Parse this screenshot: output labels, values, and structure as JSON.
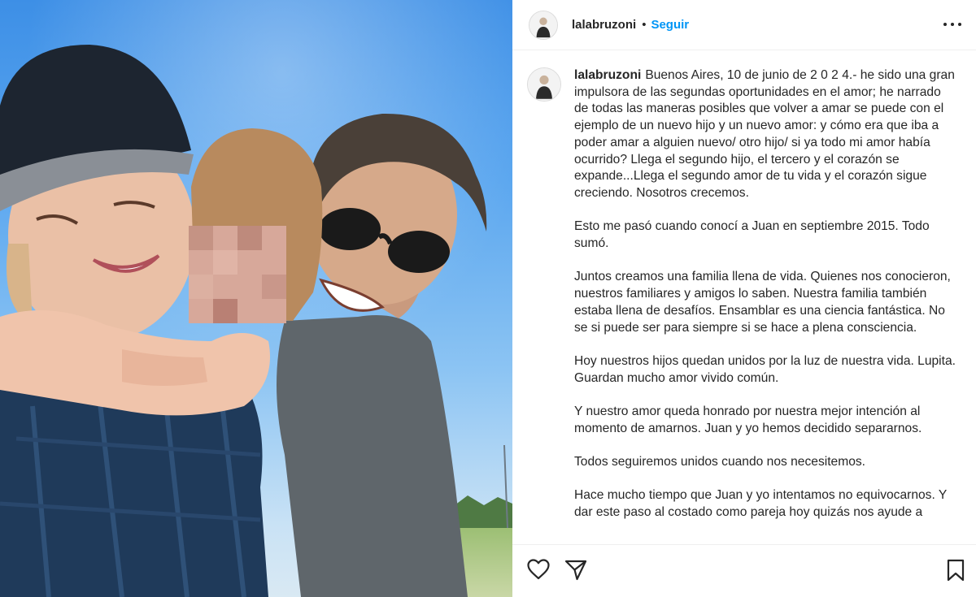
{
  "post": {
    "username": "lalabruzoni",
    "separator": "•",
    "follow_label": "Seguir"
  },
  "caption": {
    "username": "lalabruzoni",
    "paragraphs": [
      "Buenos Aires, 10 de junio de 2 0 2 4.- he sido una gran impulsora de las segundas oportunidades en el amor; he narrado de todas las maneras posibles que volver a amar se puede con el ejemplo de un nuevo hijo y un nuevo amor: y cómo era que iba a poder amar a alguien nuevo/ otro hijo/ si ya todo mi amor había ocurrido? Llega el segundo hijo, el tercero y el corazón se expande...Llega el segundo amor de tu vida y el corazón sigue creciendo. Nosotros crecemos.",
      "Esto me pasó cuando conocí a Juan en septiembre 2015. Todo sumó.",
      "Juntos creamos una familia llena de vida. Quienes nos conocieron, nuestros familiares y amigos lo saben. Nuestra familia también estaba llena de desafíos. Ensamblar es una ciencia fantástica. No se si puede ser para siempre si se hace a plena consciencia.",
      "Hoy nuestros hijos quedan unidos por la luz de nuestra vida. Lupita. Guardan mucho amor vivido común.",
      "Y nuestro amor queda honrado por nuestra mejor intención al momento de amarnos. Juan y yo hemos decidido separarnos.",
      "Todos seguiremos unidos cuando nos necesitemos.",
      "Hace mucho tiempo que Juan y yo intentamos no equivocarnos. Y dar este paso al costado como pareja hoy quizás nos ayude a"
    ]
  },
  "icons": {
    "more": "more-horizontal-icon",
    "like": "heart-icon",
    "share": "paper-plane-icon",
    "save": "bookmark-icon"
  },
  "colors": {
    "follow": "#0095f6",
    "text": "#262626",
    "divider": "#efefef"
  }
}
